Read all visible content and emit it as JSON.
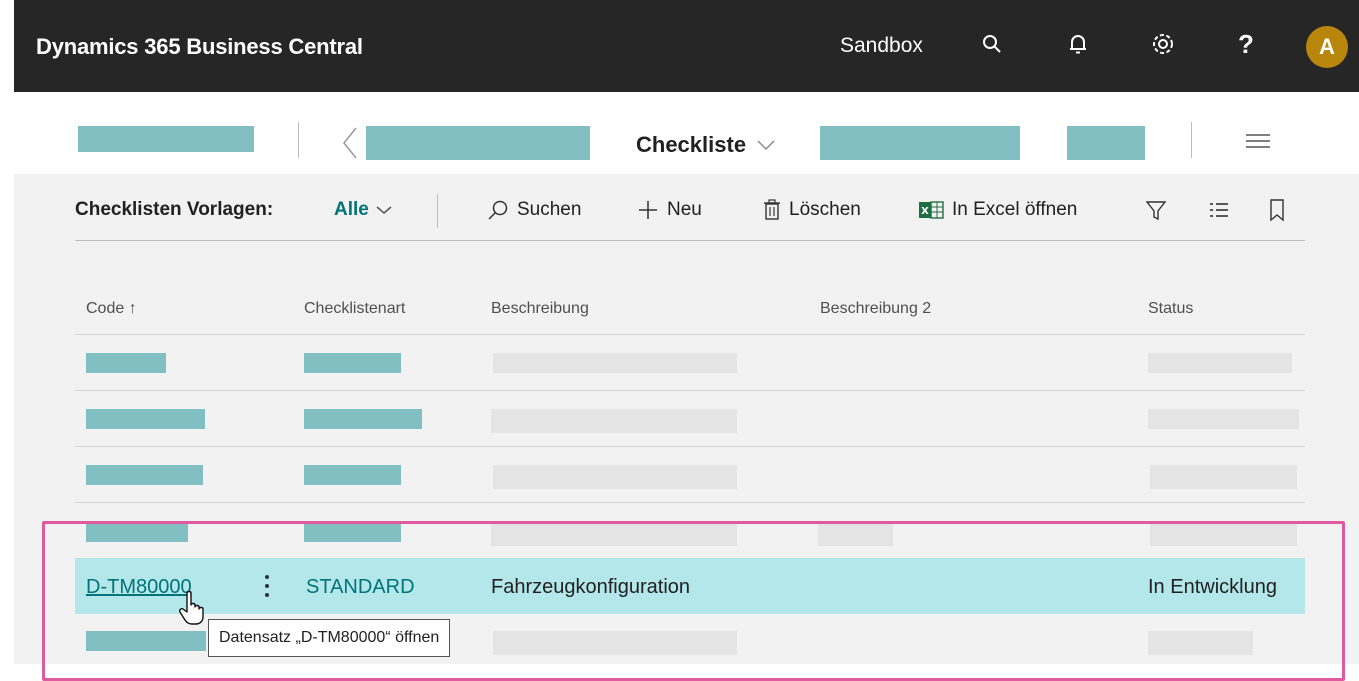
{
  "app": {
    "title": "Dynamics 365 Business Central",
    "environment": "Sandbox",
    "avatar_initial": "A"
  },
  "topbar_icons": [
    "search-icon",
    "bell-icon",
    "gear-icon",
    "help-icon"
  ],
  "help_label": "?",
  "page": {
    "title": "Checkliste"
  },
  "actions": {
    "filter_label": "Checklisten Vorlagen:",
    "view_label": "Alle",
    "search_label": "Suchen",
    "new_label": "Neu",
    "delete_label": "Löschen",
    "excel_label": "In Excel öffnen"
  },
  "table": {
    "columns": [
      "Code ↑",
      "Checklistenart",
      "Beschreibung",
      "Beschreibung 2",
      "Status"
    ],
    "selected_row": {
      "code": "D-TM80000",
      "type": "STANDARD",
      "description": "Fahrzeugkonfiguration",
      "description2": "",
      "status": "In Entwicklung"
    }
  },
  "tooltip": "Datensatz „D-TM80000“ öffnen",
  "colors": {
    "topbar": "#262626",
    "accent": "#00747a",
    "selection": "#b3e7ea",
    "highlight": "#e05aa0",
    "redaction": "#81bfc2"
  }
}
